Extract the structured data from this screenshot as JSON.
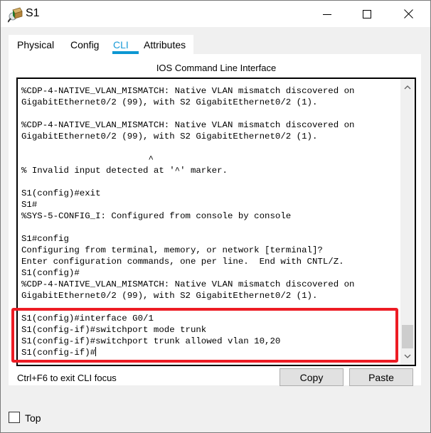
{
  "window": {
    "title": "S1",
    "icon": "packet-tracer-switch-icon",
    "controls": [
      "minimize-icon",
      "maximize-icon",
      "close-icon"
    ]
  },
  "tabs": [
    {
      "label": "Physical",
      "active": false
    },
    {
      "label": "Config",
      "active": false
    },
    {
      "label": "CLI",
      "active": true
    },
    {
      "label": "Attributes",
      "active": false
    }
  ],
  "cli": {
    "heading": "IOS Command Line Interface",
    "lines": [
      "%CDP-4-NATIVE_VLAN_MISMATCH: Native VLAN mismatch discovered on",
      "GigabitEthernet0/2 (99), with S2 GigabitEthernet0/2 (1).",
      "",
      "%CDP-4-NATIVE_VLAN_MISMATCH: Native VLAN mismatch discovered on",
      "GigabitEthernet0/2 (99), with S2 GigabitEthernet0/2 (1).",
      "",
      "                        ^",
      "% Invalid input detected at '^' marker.",
      "",
      "S1(config)#exit",
      "S1#",
      "%SYS-5-CONFIG_I: Configured from console by console",
      "",
      "S1#config",
      "Configuring from terminal, memory, or network [terminal]?",
      "Enter configuration commands, one per line.  End with CNTL/Z.",
      "S1(config)#",
      "%CDP-4-NATIVE_VLAN_MISMATCH: Native VLAN mismatch discovered on",
      "GigabitEthernet0/2 (99), with S2 GigabitEthernet0/2 (1).",
      "",
      "S1(config)#interface G0/1",
      "S1(config-if)#switchport mode trunk",
      "S1(config-if)#switchport trunk allowed vlan 10,20",
      "S1(config-if)#"
    ],
    "highlight_color": "#ed1c24"
  },
  "footer": {
    "hint": "Ctrl+F6 to exit CLI focus",
    "copy_label": "Copy",
    "paste_label": "Paste",
    "top_label": "Top",
    "top_checked": false
  },
  "colors": {
    "accent": "#0c97d2",
    "active_tab_text": "#1a9bd7"
  }
}
